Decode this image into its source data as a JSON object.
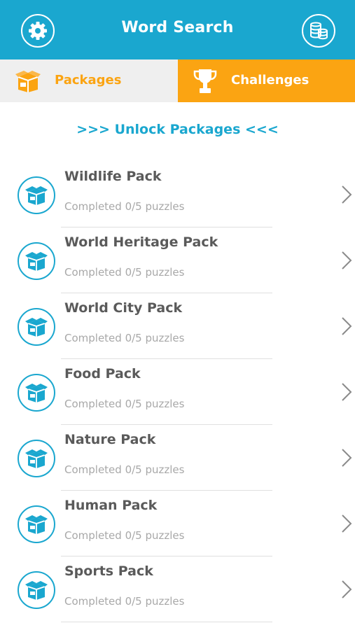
{
  "header": {
    "title": "Word Search",
    "settings_icon": "gear-icon",
    "coins_icon": "coins-stack-icon"
  },
  "tabs": [
    {
      "label": "Packages",
      "icon": "package-box-icon",
      "active": true
    },
    {
      "label": "Challenges",
      "icon": "trophy-icon",
      "active": false
    }
  ],
  "unlock_label": ">>> Unlock Packages <<<",
  "packs": [
    {
      "name": "Wildlife Pack",
      "progress": "Completed 0/5 puzzles"
    },
    {
      "name": "World Heritage Pack",
      "progress": "Completed 0/5 puzzles"
    },
    {
      "name": "World City Pack",
      "progress": "Completed 0/5 puzzles"
    },
    {
      "name": "Food Pack",
      "progress": "Completed 0/5 puzzles"
    },
    {
      "name": "Nature Pack",
      "progress": "Completed 0/5 puzzles"
    },
    {
      "name": "Human Pack",
      "progress": "Completed 0/5 puzzles"
    },
    {
      "name": "Sports Pack",
      "progress": "Completed 0/5 puzzles"
    }
  ],
  "colors": {
    "primary": "#1aa7cf",
    "accent": "#fba412",
    "tab_inactive_bg": "#efefef"
  }
}
